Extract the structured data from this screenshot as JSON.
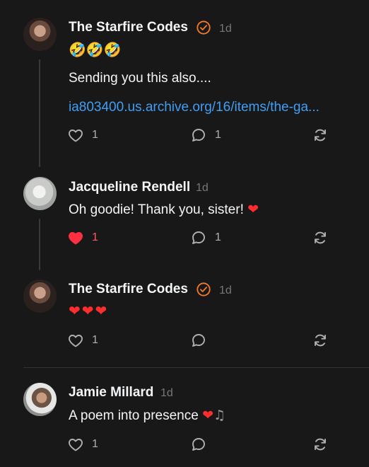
{
  "colors": {
    "background": "#181818",
    "verified": "#f27b2b",
    "link": "#3f9ef5",
    "liked": "#ff5a5f",
    "muted": "#777777"
  },
  "posts": [
    {
      "author": "The Starfire Codes",
      "verified": true,
      "time": "1d",
      "emoji_line": "🤣🤣🤣",
      "text": "Sending you this also....",
      "link": "ia803400.us.archive.org/16/items/the-ga...",
      "likes": "1",
      "replies": "1",
      "liked": false
    },
    {
      "author": "Jacqueline Rendell",
      "verified": false,
      "time": "1d",
      "text": "Oh goodie! Thank you, sister!",
      "text_emoji": "❤",
      "likes": "1",
      "replies": "1",
      "liked": true
    },
    {
      "author": "The Starfire Codes",
      "verified": true,
      "time": "1d",
      "emoji_line": "❤❤❤",
      "likes": "1",
      "replies": "",
      "liked": false
    },
    {
      "author": "Jamie Millard",
      "verified": false,
      "time": "1d",
      "text": "A poem into presence",
      "text_emoji": "❤",
      "text_note": "♫",
      "likes": "1",
      "replies": "",
      "liked": false
    }
  ],
  "icons": [
    "heart-icon",
    "comment-icon",
    "repost-icon",
    "verified-badge-icon"
  ]
}
